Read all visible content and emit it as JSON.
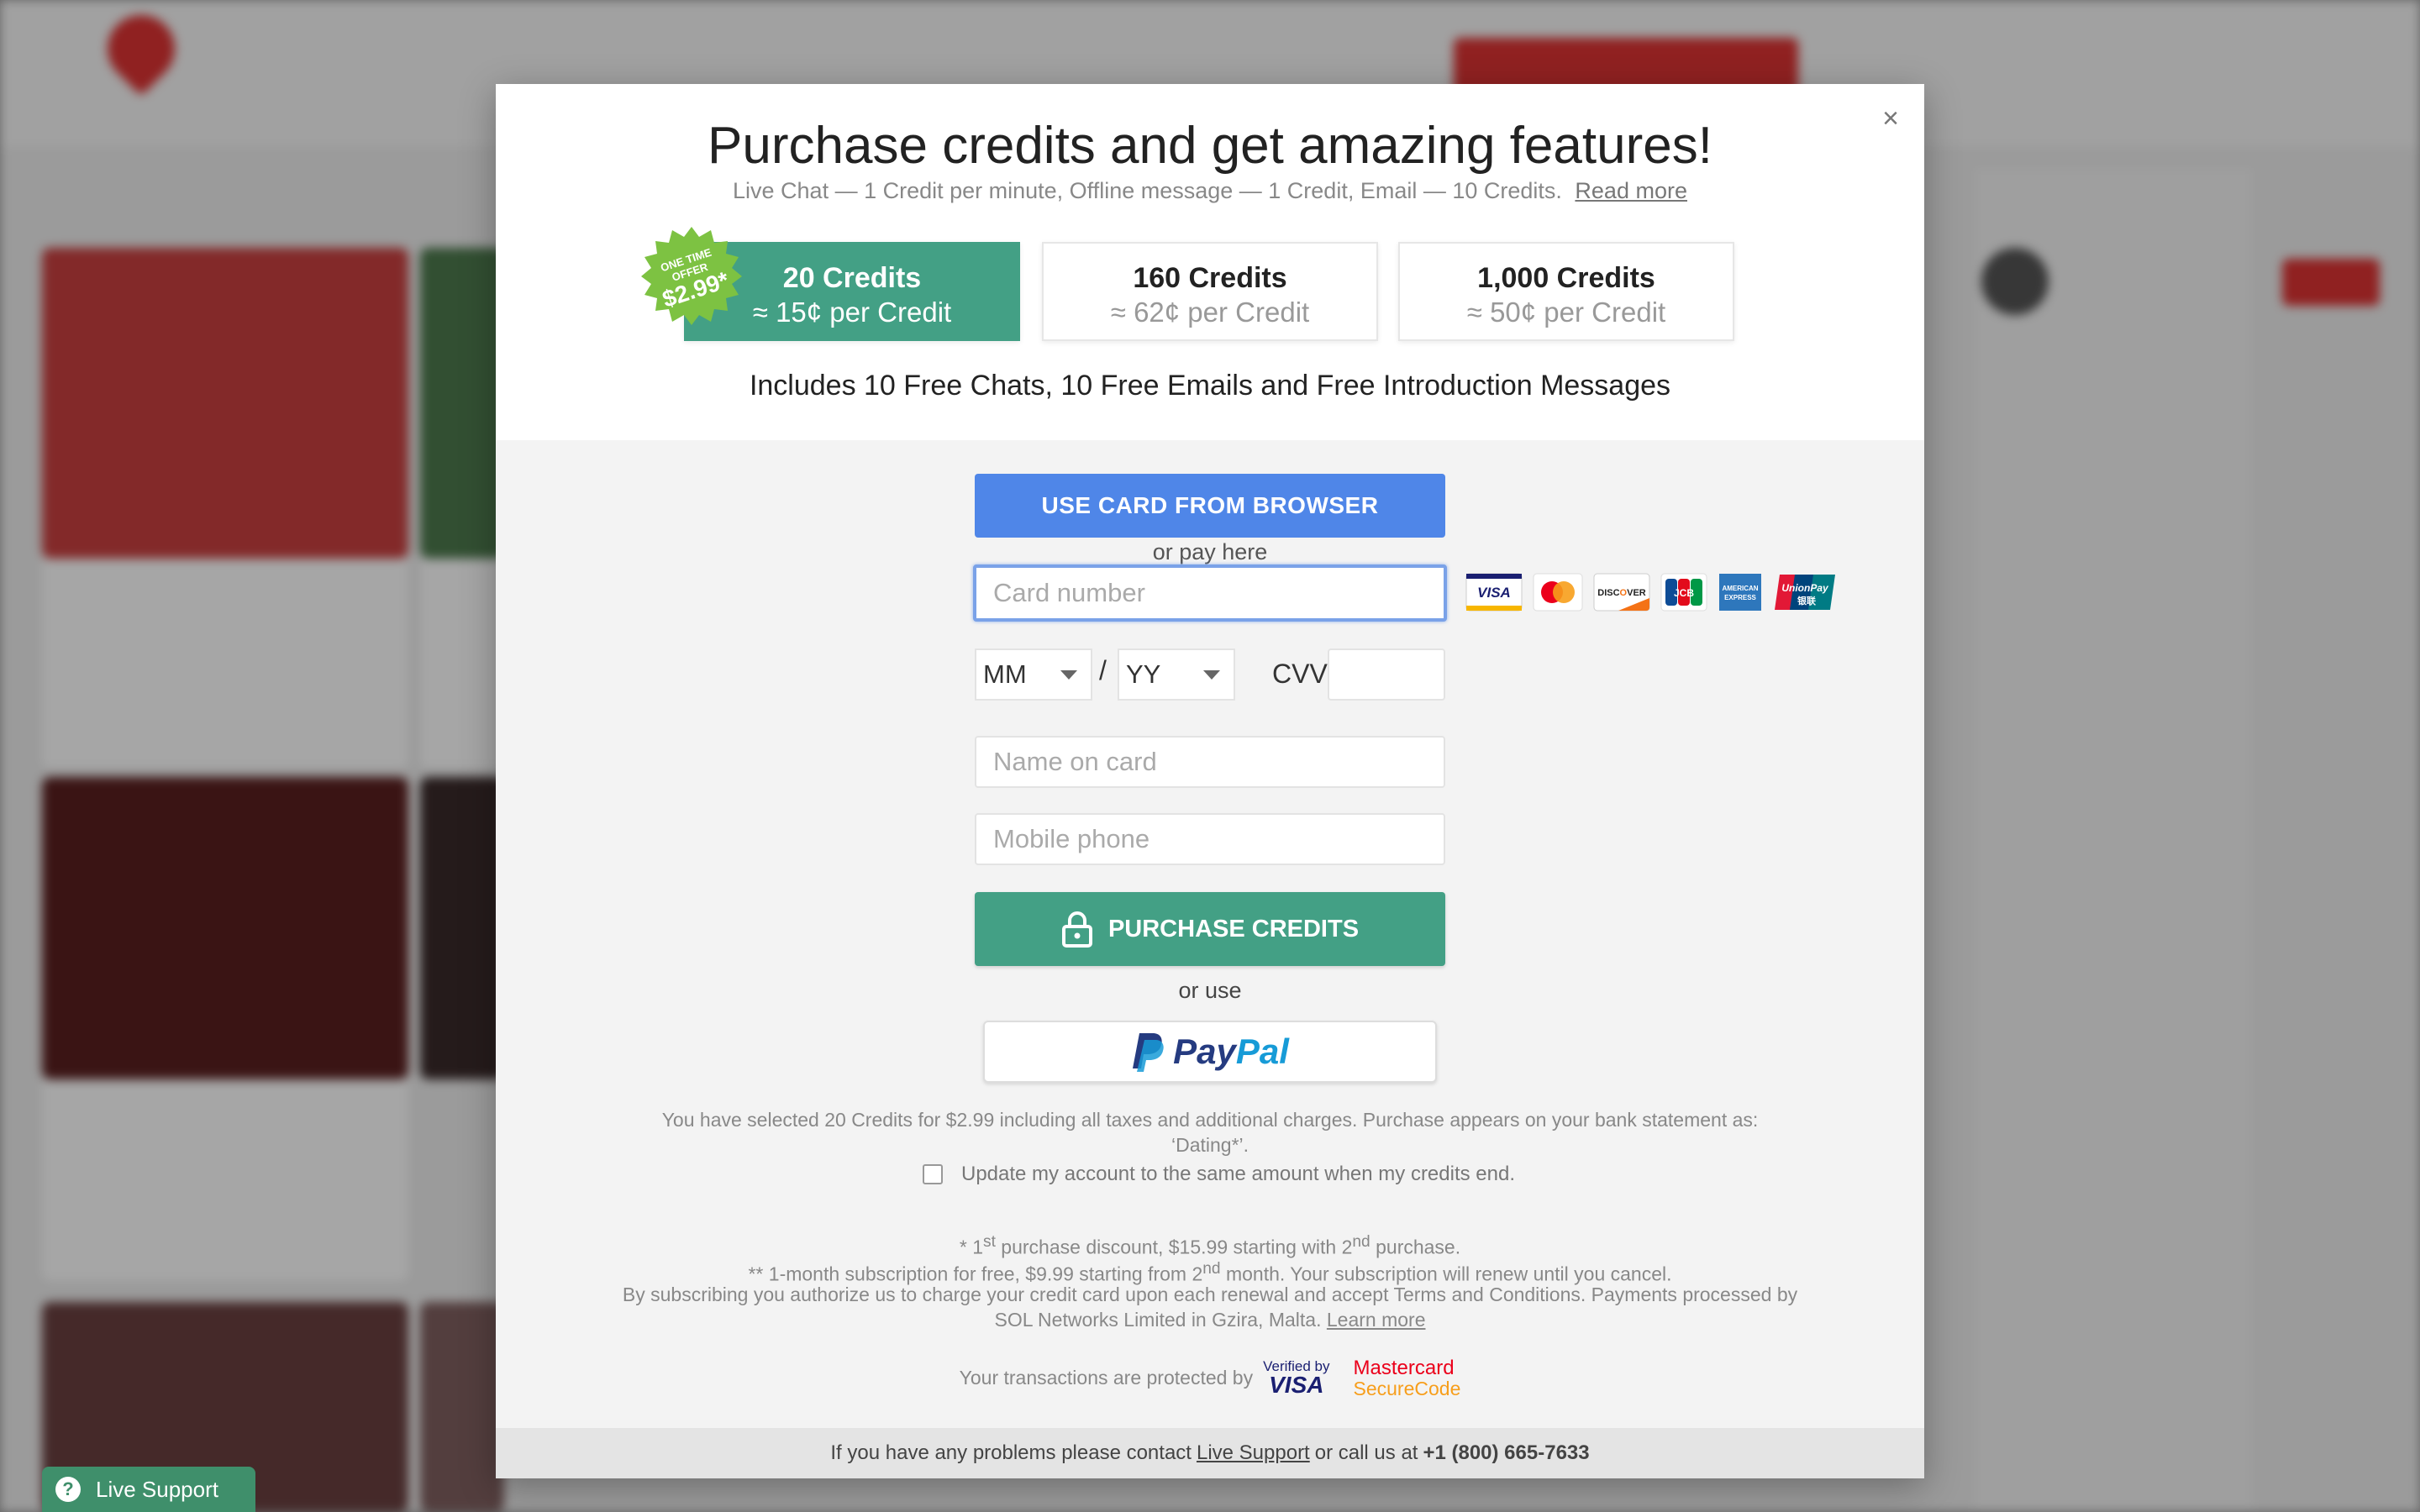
{
  "modal": {
    "close_label": "×",
    "title": "Purchase credits and get amazing features!",
    "subtitle": "Live Chat — 1 Credit per minute, Offline message — 1 Credit, Email — 10 Credits.",
    "read_more": "Read more",
    "badge": {
      "line1": "ONE TIME",
      "line2": "OFFER",
      "price": "$2.99*"
    },
    "packages": [
      {
        "credits": "20 Credits",
        "price": "≈ 15¢ per Credit",
        "selected": true
      },
      {
        "credits": "160 Credits",
        "price": "≈ 62¢ per Credit",
        "selected": false
      },
      {
        "credits": "1,000 Credits",
        "price": "≈ 50¢ per Credit",
        "selected": false
      }
    ],
    "includes": "Includes 10 Free Chats, 10 Free Emails and Free Introduction Messages"
  },
  "payment": {
    "browser_button": "USE CARD FROM BROWSER",
    "or_pay_here": "or pay here",
    "card_number_placeholder": "Card number",
    "month": "MM",
    "year": "YY",
    "slash": "/",
    "cvv_label": "CVV",
    "name_placeholder": "Name on card",
    "phone_placeholder": "Mobile phone",
    "purchase_button": "PURCHASE CREDITS",
    "or_use": "or use",
    "paypal_pay": "Pay",
    "paypal_pal": "Pal",
    "card_brands": [
      "visa-icon",
      "mastercard-icon",
      "discover-icon",
      "jcb-icon",
      "amex-icon",
      "unionpay-icon"
    ]
  },
  "legal": {
    "selection_line1": "You have selected 20 Credits for $2.99 including all taxes and additional charges. Purchase appears on your bank statement as:",
    "selection_line2": "‘Dating*’.",
    "auto_update": "Update my account to the same amount when my credits end.",
    "discount_a": "* 1",
    "discount_sup1": "st",
    "discount_b": " purchase discount, $15.99 starting with 2",
    "discount_sup2": "nd",
    "discount_c": " purchase.",
    "sub_a": "** 1-month subscription for free, $9.99 starting from 2",
    "sub_sup": "nd",
    "sub_b": " month. Your subscription will renew until you cancel.",
    "authorize": "By subscribing you authorize us to charge your credit card upon each renewal and accept Terms and Conditions. Payments processed by",
    "processor": "SOL Networks Limited in Gzira, Malta.",
    "learn_more": "Learn more",
    "protected_by": "Your transactions are protected by",
    "verified_by": "Verified by",
    "visa": "VISA",
    "mastercard": "Mastercard",
    "securecode": "SecureCode"
  },
  "footer": {
    "text_before": "If you have any problems please contact",
    "live_support": "Live Support",
    "text_mid": "or call us at",
    "phone": "+1 (800) 665-7633"
  },
  "page": {
    "live_support_tab": "Live Support"
  },
  "colors": {
    "green": "#43a085",
    "blue": "#4f86e8",
    "badge_green": "#7dc242"
  }
}
